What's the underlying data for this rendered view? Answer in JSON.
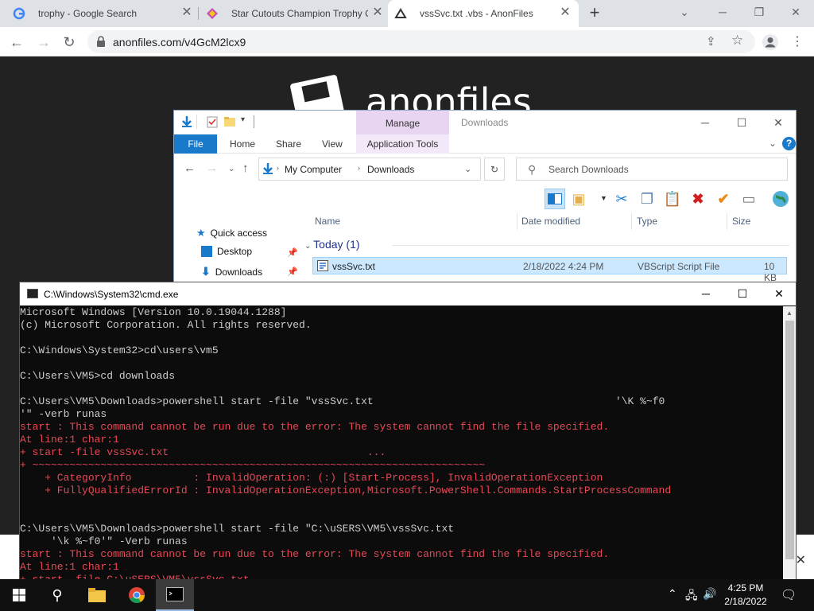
{
  "browser": {
    "tabs": [
      {
        "title": "trophy - Google Search",
        "active": false
      },
      {
        "title": "Star Cutouts Champion Trophy C",
        "active": false
      },
      {
        "title": "vssSvc.txt .vbs - AnonFiles",
        "active": true
      }
    ],
    "new_tab": "+",
    "url": "anonfiles.com/v4GcM2lcx9"
  },
  "page": {
    "logo_text": "anonfiles"
  },
  "explorer": {
    "manage_label": "Manage",
    "window_title": "Downloads",
    "ribbon_tabs": [
      "File",
      "Home",
      "Share",
      "View"
    ],
    "app_tools": "Application Tools",
    "address": [
      "My Computer",
      "Downloads"
    ],
    "search_placeholder": "Search Downloads",
    "nav": [
      "Quick access",
      "Desktop",
      "Downloads"
    ],
    "columns": [
      "Name",
      "Date modified",
      "Type",
      "Size"
    ],
    "group": "Today (1)",
    "file": {
      "name": "vssSvc.txt",
      "date": "2/18/2022 4:24 PM",
      "type": "VBScript Script File",
      "size": "10 KB"
    }
  },
  "cmd": {
    "title": "C:\\Windows\\System32\\cmd.exe",
    "lines": [
      {
        "t": "Microsoft Windows [Version 10.0.19044.1288]",
        "err": false
      },
      {
        "t": "(c) Microsoft Corporation. All rights reserved.",
        "err": false
      },
      {
        "t": "",
        "err": false
      },
      {
        "t": "C:\\Windows\\System32>cd\\users\\vm5",
        "err": false
      },
      {
        "t": "",
        "err": false
      },
      {
        "t": "C:\\Users\\VM5>cd downloads",
        "err": false
      },
      {
        "t": "",
        "err": false
      },
      {
        "t": "C:\\Users\\VM5\\Downloads>powershell start -file \"vssSvc.txt                                       '\\K %~f0",
        "err": false
      },
      {
        "t": "'\" -verb runas",
        "err": false
      },
      {
        "t": "start : This command cannot be run due to the error: The system cannot find the file specified.",
        "err": true
      },
      {
        "t": "At line:1 char:1",
        "err": true
      },
      {
        "t": "+ start -file vssSvc.txt                                ...",
        "err": true
      },
      {
        "t": "+ ~~~~~~~~~~~~~~~~~~~~~~~~~~~~~~~~~~~~~~~~~~~~~~~~~~~~~~~~~~~~~~~~~~~~~~~~~",
        "err": true
      },
      {
        "t": "    + CategoryInfo          : InvalidOperation: (:) [Start-Process], InvalidOperationException",
        "err": true
      },
      {
        "t": "    + FullyQualifiedErrorId : InvalidOperationException,Microsoft.PowerShell.Commands.StartProcessCommand",
        "err": true
      },
      {
        "t": "",
        "err": false
      },
      {
        "t": "",
        "err": false
      },
      {
        "t": "C:\\Users\\VM5\\Downloads>powershell start -file \"C:\\uSERS\\VM5\\vssSvc.txt",
        "err": false
      },
      {
        "t": "     '\\k %~f0'\" -Verb runas",
        "err": false
      },
      {
        "t": "start : This command cannot be run due to the error: The system cannot find the file specified.",
        "err": true
      },
      {
        "t": "At line:1 char:1",
        "err": true
      },
      {
        "t": "+ start -file C:\\uSERS\\VM5\\vssSvc.txt",
        "err": true
      }
    ]
  },
  "taskbar": {
    "time": "4:25 PM",
    "date": "2/18/2022"
  }
}
